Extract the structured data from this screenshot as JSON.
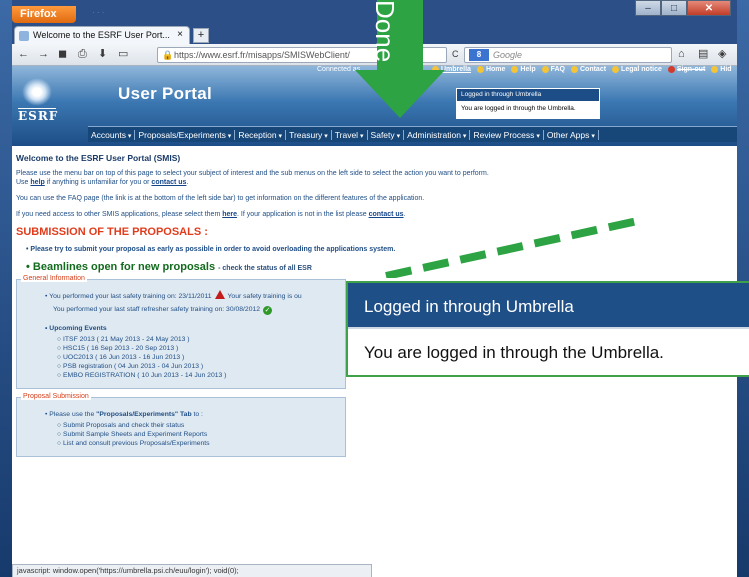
{
  "browser": {
    "menu_button": "Firefox",
    "tab_title": "Welcome to the ESRF User Port...",
    "url": "https://www.esrf.fr/misapps/SMISWebClient/",
    "search_placeholder": "Google",
    "status_text": "javascript: window.open('https://umbrella.psi.ch/euu/login'); void(0);"
  },
  "header": {
    "logo_text": "ESRF",
    "title": "User Portal",
    "connected_text": "Connected as",
    "top_links": [
      "Umbrella",
      "Home",
      "Help",
      "FAQ",
      "Contact",
      "Legal notice",
      "Sign-out",
      "Hid"
    ]
  },
  "small_popup": {
    "heading": "Logged in through Umbrella",
    "body": "You are logged in through the Umbrella."
  },
  "menu": [
    "Accounts",
    "Proposals/Experiments",
    "Reception",
    "Treasury",
    "Travel",
    "Safety",
    "Administration",
    "Review Process",
    "Other Apps"
  ],
  "content": {
    "welcome": "Welcome to the ESRF User Portal (SMIS)",
    "intro_1a": "Please use the menu bar on top of this page to select your subject of interest and the sub menus on the left side to select the action you want to perform.",
    "intro_1b_pre": "Use",
    "help_link": "help",
    "intro_1b_mid": "if anything is unfamiliar for you or",
    "contact_link": "contact us",
    "intro_2": "You can use the FAQ page (the link is at the bottom of the left side bar) to get information on the different features of the application.",
    "intro_3_pre": "If you need access to other SMIS applications, please select them",
    "here_link": "here",
    "intro_3_mid": ". If your application is not in the list please",
    "submission_title": "SUBMISSION OF THE PROPOSALS :",
    "submission_note": "Please try to submit your proposal as early as possible in order to avoid overloading the applications system.",
    "beamlines_title": "Beamlines open for new proposals",
    "beamlines_sub": "- check the status of all ESR",
    "general_legend": "General Information",
    "safety_line": "You performed your last safety training on: 23/11/2011",
    "safety_tail": "Your safety training is ou",
    "refresher_line": "You performed your last staff refresher safety training on: 30/08/2012",
    "events_title": "Upcoming Events",
    "events": [
      "ITSF 2013 ( 21 May 2013 - 24 May 2013 )",
      "HSC15 ( 16 Sep 2013 - 20 Sep 2013 )",
      "UOC2013 ( 16 Jun 2013 - 16 Jun 2013 )",
      "PSB registration ( 04 Jun 2013 - 04 Jun 2013 )",
      "EMBO REGISTRATION ( 10 Jun 2013 - 14 Jun 2013 )"
    ],
    "proposal_legend": "Proposal Submission",
    "proposal_intro_pre": "Please use the",
    "proposal_tab": "\"Proposals/Experiments\" Tab",
    "proposal_intro_post": "to :",
    "proposal_items": [
      "Submit Proposals and check their status",
      "Submit Sample Sheets and Experiment Reports",
      "List and consult previous Proposals/Experiments"
    ]
  },
  "overlay": {
    "arrow_label": "Done",
    "zoom_heading": "Logged in through Umbrella",
    "zoom_body": "You are logged in through the Umbrella.",
    "accent_color": "#2da344"
  }
}
